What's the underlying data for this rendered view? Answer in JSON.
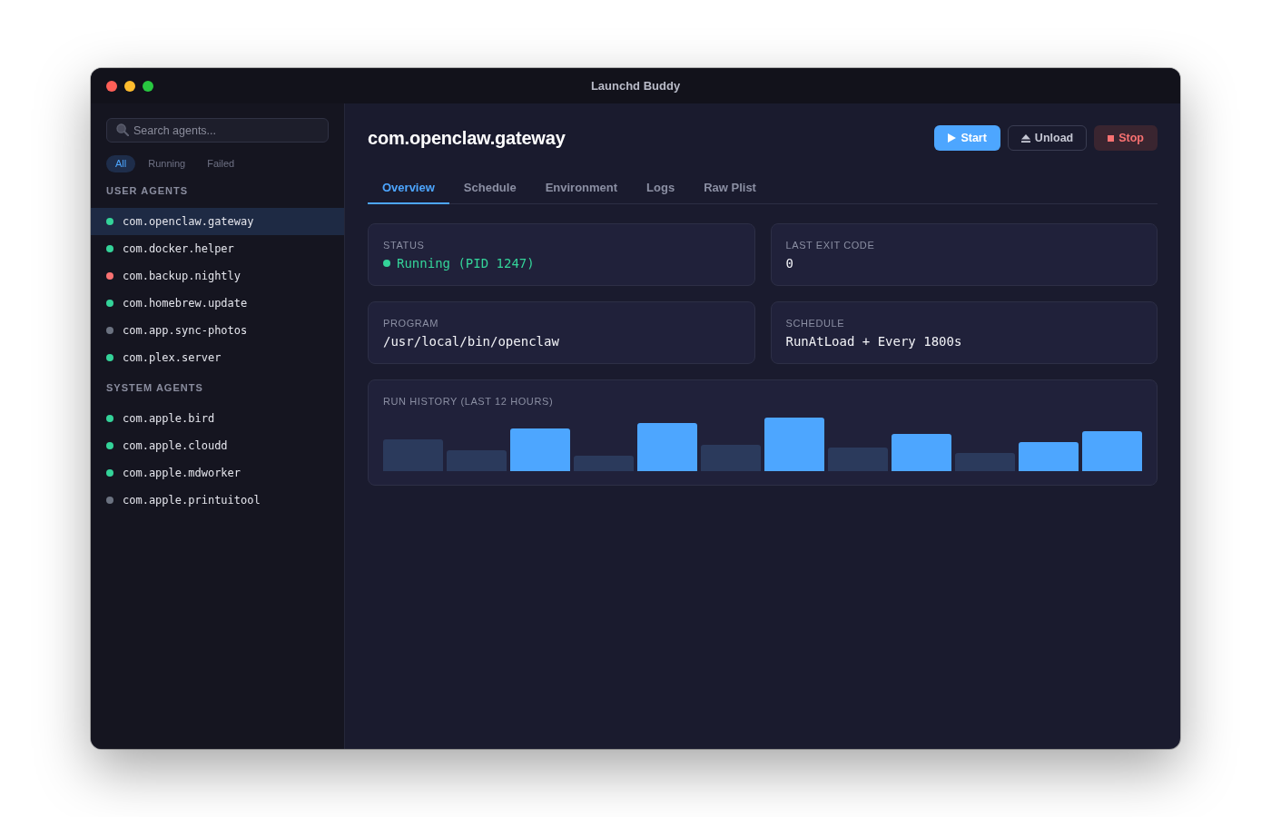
{
  "window": {
    "title": "Launchd Buddy"
  },
  "sidebar": {
    "search": {
      "placeholder": "Search agents..."
    },
    "filters": [
      {
        "label": "All",
        "selected": true
      },
      {
        "label": "Running",
        "selected": false
      },
      {
        "label": "Failed",
        "selected": false
      }
    ],
    "sections": [
      {
        "title": "USER AGENTS",
        "items": [
          {
            "name": "com.openclaw.gateway",
            "color": "#34d399",
            "selected": true
          },
          {
            "name": "com.docker.helper",
            "color": "#34d399",
            "selected": false
          },
          {
            "name": "com.backup.nightly",
            "color": "#f87171",
            "selected": false
          },
          {
            "name": "com.homebrew.update",
            "color": "#34d399",
            "selected": false
          },
          {
            "name": "com.app.sync-photos",
            "color": "#6b7280",
            "selected": false
          },
          {
            "name": "com.plex.server",
            "color": "#34d399",
            "selected": false
          }
        ]
      },
      {
        "title": "SYSTEM AGENTS",
        "items": [
          {
            "name": "com.apple.bird",
            "color": "#34d399",
            "selected": false
          },
          {
            "name": "com.apple.cloudd",
            "color": "#34d399",
            "selected": false
          },
          {
            "name": "com.apple.mdworker",
            "color": "#34d399",
            "selected": false
          },
          {
            "name": "com.apple.printuitool",
            "color": "#6b7280",
            "selected": false
          }
        ]
      }
    ]
  },
  "detail": {
    "title": "com.openclaw.gateway",
    "buttons": [
      {
        "label": "Start",
        "kind": "primary"
      },
      {
        "label": "Unload",
        "kind": "outline"
      },
      {
        "label": "Stop",
        "kind": "danger"
      }
    ],
    "tabs": [
      {
        "label": "Overview",
        "selected": true
      },
      {
        "label": "Schedule",
        "selected": false
      },
      {
        "label": "Environment",
        "selected": false
      },
      {
        "label": "Logs",
        "selected": false
      },
      {
        "label": "Raw Plist",
        "selected": false
      }
    ],
    "cards": [
      {
        "label": "STATUS",
        "value": "Running (PID 1247)",
        "color": "#34d399"
      },
      {
        "label": "LAST EXIT CODE",
        "value": "0"
      },
      {
        "label": "PROGRAM",
        "value": "/usr/local/bin/openclaw"
      },
      {
        "label": "SCHEDULE",
        "value": "RunAtLoad + Every 1800s"
      }
    ],
    "run_history": {
      "title": "RUN HISTORY (LAST 12 HOURS)"
    }
  }
}
